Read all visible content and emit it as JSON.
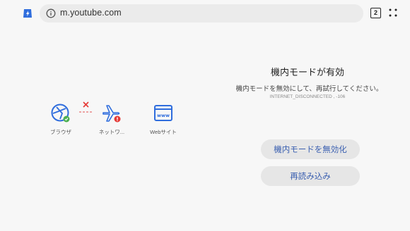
{
  "address_bar": {
    "url": "m.youtube.com",
    "tab_count": "2"
  },
  "icons": {
    "brand": "browser-logo-icon",
    "info": "info-icon",
    "menu": "more-grid-icon",
    "browser": "browser-globe-icon",
    "network": "airplane-icon",
    "website": "www-window-icon",
    "connection_broken": "x-icon"
  },
  "diagram": {
    "browser_label": "ブラウザ",
    "network_label": "ネットワ...",
    "website_label": "Webサイト",
    "website_badge": "www"
  },
  "error": {
    "title": "機内モードが有効",
    "message": "機内モードを無効にして、再試行してください。",
    "code": "INTERNET_DISCONNECTED , -106"
  },
  "buttons": {
    "disable_airplane": "機内モードを無効化",
    "reload": "再読み込み"
  },
  "colors": {
    "accent": "#2f6ddd",
    "ok": "#4caf50",
    "error": "#e53935",
    "button_text": "#3a5fb0"
  }
}
